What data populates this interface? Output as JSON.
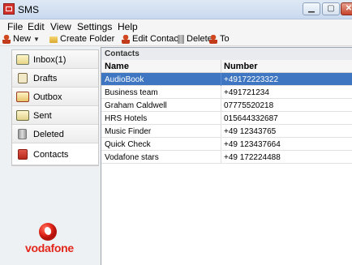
{
  "window": {
    "title": "SMS"
  },
  "menu": [
    "File",
    "Edit",
    "View",
    "Settings",
    "Help"
  ],
  "toolbar": {
    "new_label": "New",
    "create_folder_label": "Create Folder",
    "edit_contact_label": "Edit Contact",
    "delete_label": "Delete",
    "to_label": "To"
  },
  "sidebar": {
    "items": [
      {
        "label": "Inbox(1)",
        "icon": "inbox-icon"
      },
      {
        "label": "Drafts",
        "icon": "drafts-icon"
      },
      {
        "label": "Outbox",
        "icon": "outbox-icon"
      },
      {
        "label": "Sent",
        "icon": "sent-icon"
      },
      {
        "label": "Deleted",
        "icon": "trash-icon"
      },
      {
        "label": "Contacts",
        "icon": "contacts-icon"
      }
    ],
    "active_index": 5,
    "brand": "vodafone"
  },
  "contacts": {
    "section_title": "Contacts",
    "columns": [
      "Name",
      "Number"
    ],
    "rows": [
      {
        "name": "AudioBook",
        "number": "+49172223322",
        "selected": true
      },
      {
        "name": "Business team",
        "number": "+491721234",
        "selected": false
      },
      {
        "name": "Graham Caldwell",
        "number": "07775520218",
        "selected": false
      },
      {
        "name": "HRS Hotels",
        "number": "015644332687",
        "selected": false
      },
      {
        "name": "Music Finder",
        "number": "+49 12343765",
        "selected": false
      },
      {
        "name": "Quick Check",
        "number": "+49 123437664",
        "selected": false
      },
      {
        "name": "Vodafone stars",
        "number": "+49 172224488",
        "selected": false
      }
    ]
  },
  "colors": {
    "selection": "#3e76c1",
    "brand_red": "#e2261b"
  }
}
